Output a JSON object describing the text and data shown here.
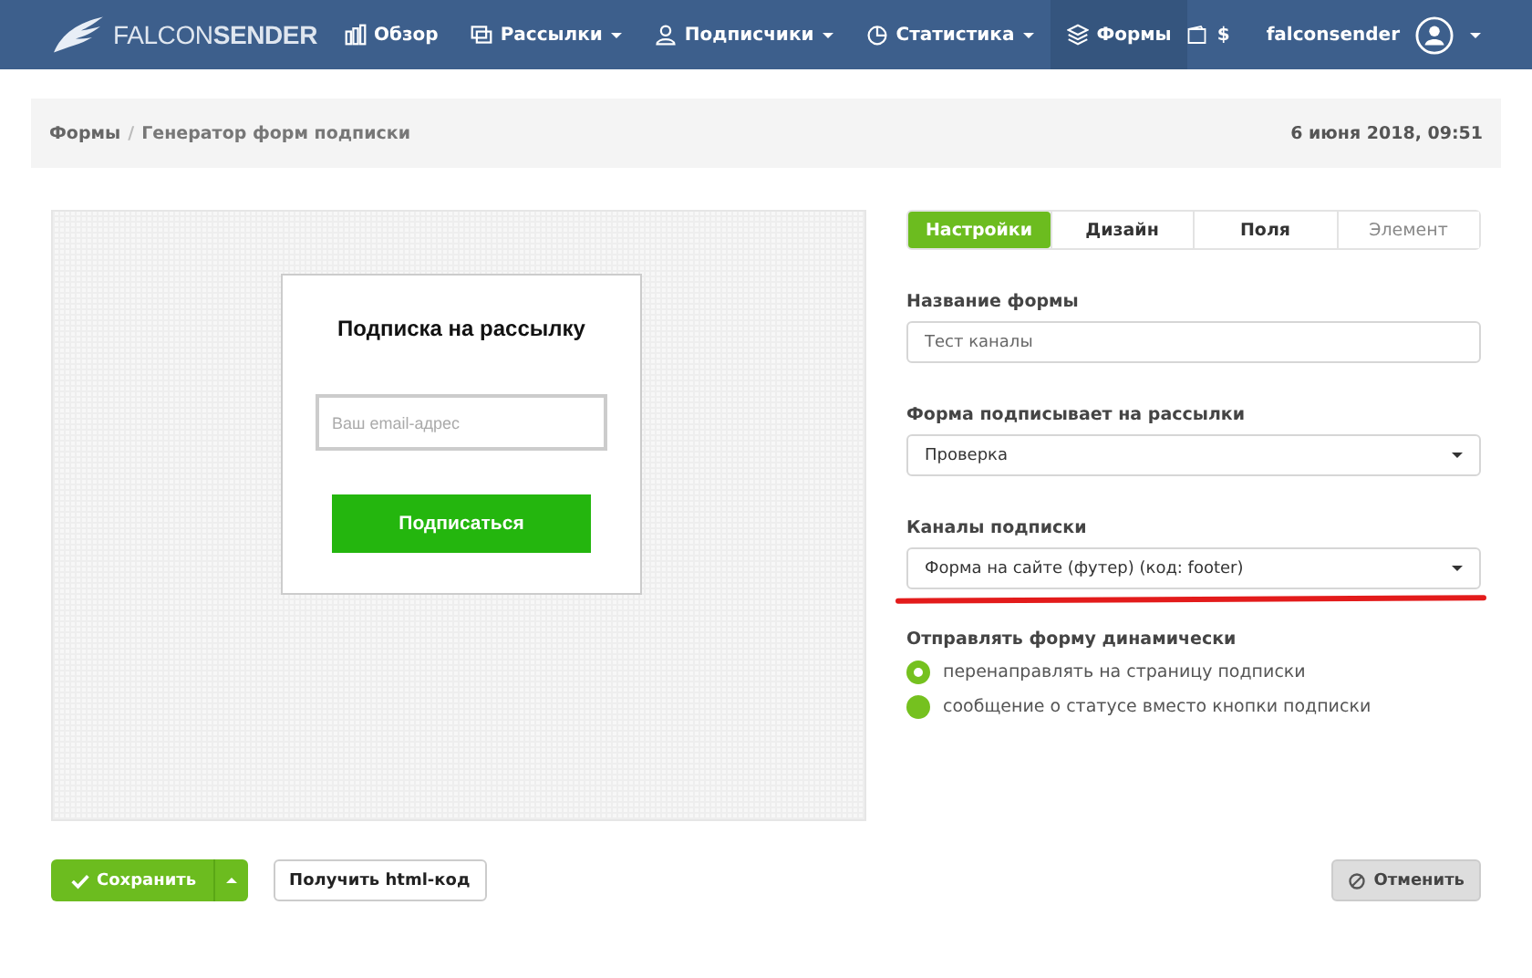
{
  "header": {
    "logo": "FALCON**SENDER**",
    "nav": [
      {
        "label": "Обзор",
        "dropdown": false,
        "selected": false
      },
      {
        "label": "Рассылки",
        "dropdown": true,
        "selected": false
      },
      {
        "label": "Подписчики",
        "dropdown": true,
        "selected": false
      },
      {
        "label": "Статистика",
        "dropdown": true,
        "selected": false
      },
      {
        "label": "Формы",
        "dropdown": false,
        "selected": true
      }
    ],
    "balance": "$",
    "user": "falconsender"
  },
  "breadcrumb": {
    "items": [
      "Формы",
      "Генератор форм подписки"
    ],
    "separator": "/",
    "date": "6 июня 2018, 09:51"
  },
  "preview": {
    "title": "Подписка на рассылку",
    "email_placeholder": "Ваш email-адрес",
    "button": "Подписаться"
  },
  "tabs": [
    {
      "label": "Настройки",
      "selected": true,
      "disabled": false
    },
    {
      "label": "Дизайн",
      "selected": false,
      "disabled": false
    },
    {
      "label": "Поля",
      "selected": false,
      "disabled": false
    },
    {
      "label": "Элемент",
      "selected": false,
      "disabled": true
    }
  ],
  "fields": [
    {
      "kind": "input",
      "label": "Название формы",
      "value": "Тест каналы",
      "highlighted": false
    },
    {
      "kind": "select",
      "label": "Форма подписывает на рассылки",
      "value": "Проверка",
      "highlighted": false
    },
    {
      "kind": "select",
      "label": "Каналы подписки",
      "value": "Форма на сайте (футер) (код: footer)",
      "highlighted": true
    }
  ],
  "dynamic": {
    "label": "Отправлять форму динамически",
    "options": [
      {
        "label": "перенаправлять на страницу подписки",
        "selected": true
      },
      {
        "label": "сообщение о статусе вместо кнопки подписки",
        "selected": false
      }
    ]
  },
  "actions": {
    "save": "Сохранить",
    "html": "Получить html-код",
    "cancel": "Отменить"
  }
}
